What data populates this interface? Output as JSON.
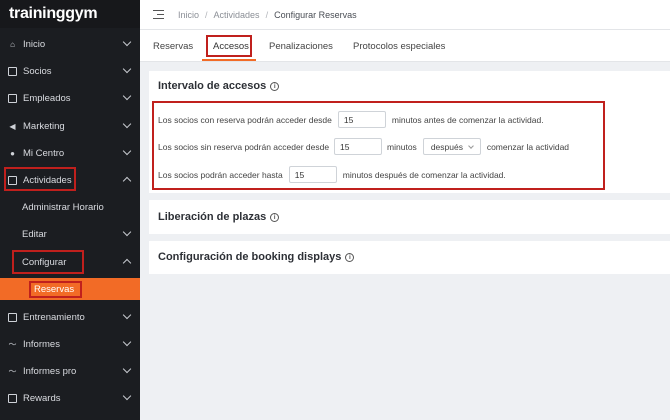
{
  "brand": {
    "logo_text": "traininggym"
  },
  "sidebar": {
    "items": [
      {
        "label": "Inicio",
        "icon": "home-icon"
      },
      {
        "label": "Socios",
        "icon": "id-card-icon"
      },
      {
        "label": "Empleados",
        "icon": "badge-icon"
      },
      {
        "label": "Marketing",
        "icon": "megaphone-icon"
      },
      {
        "label": "Mi Centro",
        "icon": "location-pin-icon"
      },
      {
        "label": "Actividades",
        "icon": "calendar-icon"
      },
      {
        "label": "Administrar Horario"
      },
      {
        "label": "Editar"
      },
      {
        "label": "Configurar"
      },
      {
        "label": "Reservas"
      },
      {
        "label": "Entrenamiento",
        "icon": "clipboard-icon"
      },
      {
        "label": "Informes",
        "icon": "chart-line-icon"
      },
      {
        "label": "Informes pro",
        "icon": "chart-line-icon"
      },
      {
        "label": "Rewards",
        "icon": "gift-icon"
      }
    ]
  },
  "header": {
    "breadcrumb": [
      "Inicio",
      "Actividades",
      "Configurar Reservas"
    ],
    "separator": "/"
  },
  "tabs": [
    {
      "label": "Reservas"
    },
    {
      "label": "Accesos",
      "active": true
    },
    {
      "label": "Penalizaciones"
    },
    {
      "label": "Protocolos especiales"
    }
  ],
  "intervalo": {
    "title": "Intervalo de accesos",
    "info": "i",
    "row1": {
      "prefix": "Los socios con reserva podrán acceder desde",
      "value": "15",
      "suffix": "minutos antes de comenzar la actividad."
    },
    "row2": {
      "prefix": "Los socios sin reserva podrán acceder desde",
      "value": "15",
      "middle": "minutos",
      "select_value": "después",
      "suffix": "comenzar la actividad"
    },
    "row3": {
      "prefix": "Los socios podrán acceder hasta",
      "value": "15",
      "suffix": "minutos después de comenzar la actividad."
    }
  },
  "liberacion": {
    "title": "Liberación de plazas",
    "info": "i"
  },
  "booking": {
    "title": "Configuración de booking displays",
    "info": "i"
  },
  "colors": {
    "accent": "#f26b26",
    "highlight": "#c0201d",
    "sidebar_bg": "#1b1d21"
  }
}
